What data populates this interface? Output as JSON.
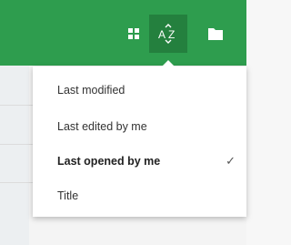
{
  "toolbar": {
    "accent_color": "#2e9d4e",
    "active_button_color": "#24803e",
    "buttons": [
      {
        "icon": "grid-view-icon"
      },
      {
        "icon": "sort-az-icon"
      },
      {
        "icon": "folder-icon"
      }
    ]
  },
  "sort_menu": {
    "items": [
      {
        "label": "Last modified",
        "selected": false
      },
      {
        "label": "Last edited by me",
        "selected": false
      },
      {
        "label": "Last opened by me",
        "selected": true
      },
      {
        "label": "Title",
        "selected": false
      }
    ],
    "checkmark": "✓"
  }
}
